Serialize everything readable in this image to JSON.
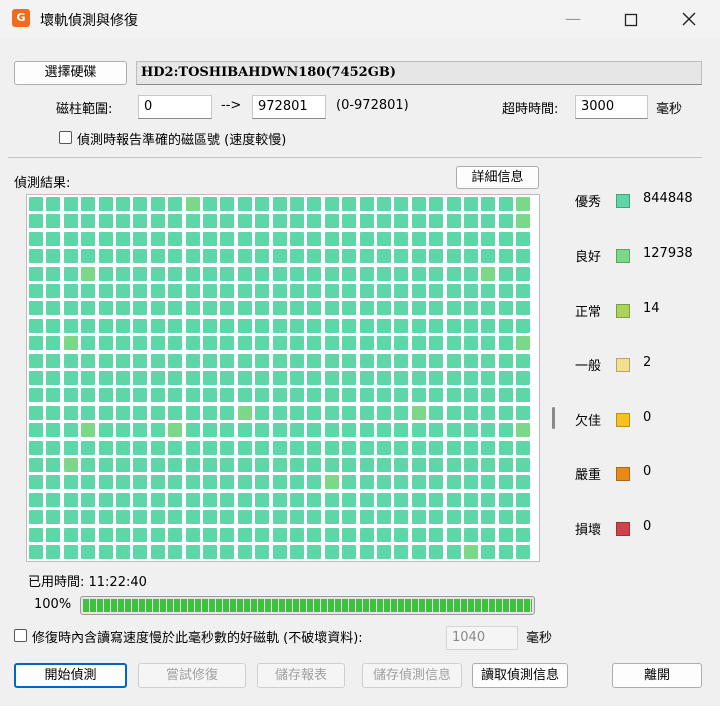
{
  "window": {
    "title": "壞軌偵測與修復",
    "app_icon_letter": "G",
    "min_icon": "minimize-icon",
    "max_icon": "maximize-icon",
    "close_icon": "close-icon"
  },
  "disk": {
    "select_label": "選擇硬碟",
    "name": "HD2:TOSHIBAHDWN180(7452GB)"
  },
  "range": {
    "label": "磁柱範圍:",
    "start": "0",
    "arrow": "-->",
    "end": "972801",
    "hint": "(0-972801)"
  },
  "timeout": {
    "label": "超時時間:",
    "value": "3000",
    "unit": "毫秒"
  },
  "report_option": {
    "label": "偵測時報告準確的磁區號 (速度較慢)",
    "checked": false
  },
  "results": {
    "label": "偵測結果:",
    "details_button": "詳細信息"
  },
  "legend": [
    {
      "name": "優秀",
      "color": "#5dd6a8",
      "count": "844848"
    },
    {
      "name": "良好",
      "color": "#7bd889",
      "count": "127938"
    },
    {
      "name": "正常",
      "color": "#a9d35b",
      "count": "14"
    },
    {
      "name": "一般",
      "color": "#f3df8c",
      "count": "2"
    },
    {
      "name": "欠佳",
      "color": "#f7c21e",
      "count": "0"
    },
    {
      "name": "嚴重",
      "color": "#e88a19",
      "count": "0"
    },
    {
      "name": "損壞",
      "color": "#d0424a",
      "count": "0"
    }
  ],
  "elapsed": {
    "label": "已用時間: 11:22:40"
  },
  "progress": {
    "percent_text": "100%",
    "value": 1.0
  },
  "repair_option": {
    "label": "修復時內含讀寫速度慢於此毫秒數的好磁軌 (不破壞資料):",
    "value": "1040",
    "unit": "毫秒",
    "checked": false
  },
  "buttons": {
    "start": "開始偵測",
    "repair": "嘗試修復",
    "save_report": "儲存報表",
    "save_info": "儲存偵測信息",
    "load_info": "讀取偵測信息",
    "exit": "離開"
  }
}
